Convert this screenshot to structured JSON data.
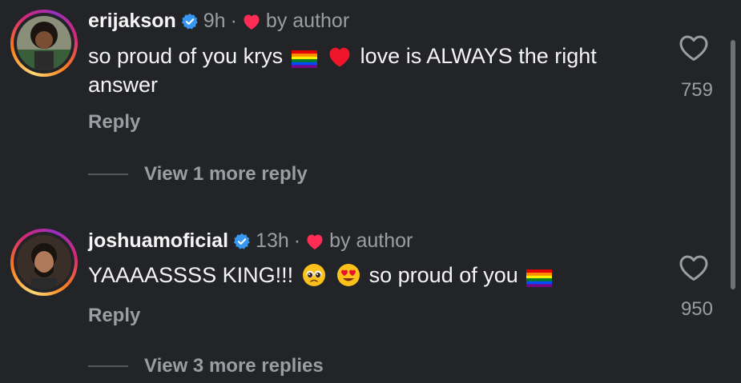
{
  "colors": {
    "background": "#232427",
    "text_primary": "#f5f5f5",
    "text_secondary": "#9a9da1",
    "verified_blue": "#3897f0",
    "heart_red": "#ff2d55"
  },
  "comments": [
    {
      "username": "erijakson",
      "verified": true,
      "time": "9h",
      "separator": "·",
      "author_like_label": "by author",
      "text_parts": [
        "so proud of you krys",
        "love is ALWAYS the right answer"
      ],
      "emojis": [
        "rainbow-flag-emoji",
        "red-heart-emoji"
      ],
      "reply_label": "Reply",
      "view_more_label": "View 1 more reply",
      "like_count": "759",
      "like_icon": "heart-outline-icon"
    },
    {
      "username": "joshuamoficial",
      "verified": true,
      "time": "13h",
      "separator": "·",
      "author_like_label": "by author",
      "text_parts": [
        "YAAAASSSS KING!!!",
        "so proud of you"
      ],
      "emojis": [
        "pleading-face-emoji",
        "heart-eyes-emoji",
        "rainbow-flag-emoji"
      ],
      "reply_label": "Reply",
      "view_more_label": "View 3 more replies",
      "like_count": "950",
      "like_icon": "heart-outline-icon"
    }
  ]
}
